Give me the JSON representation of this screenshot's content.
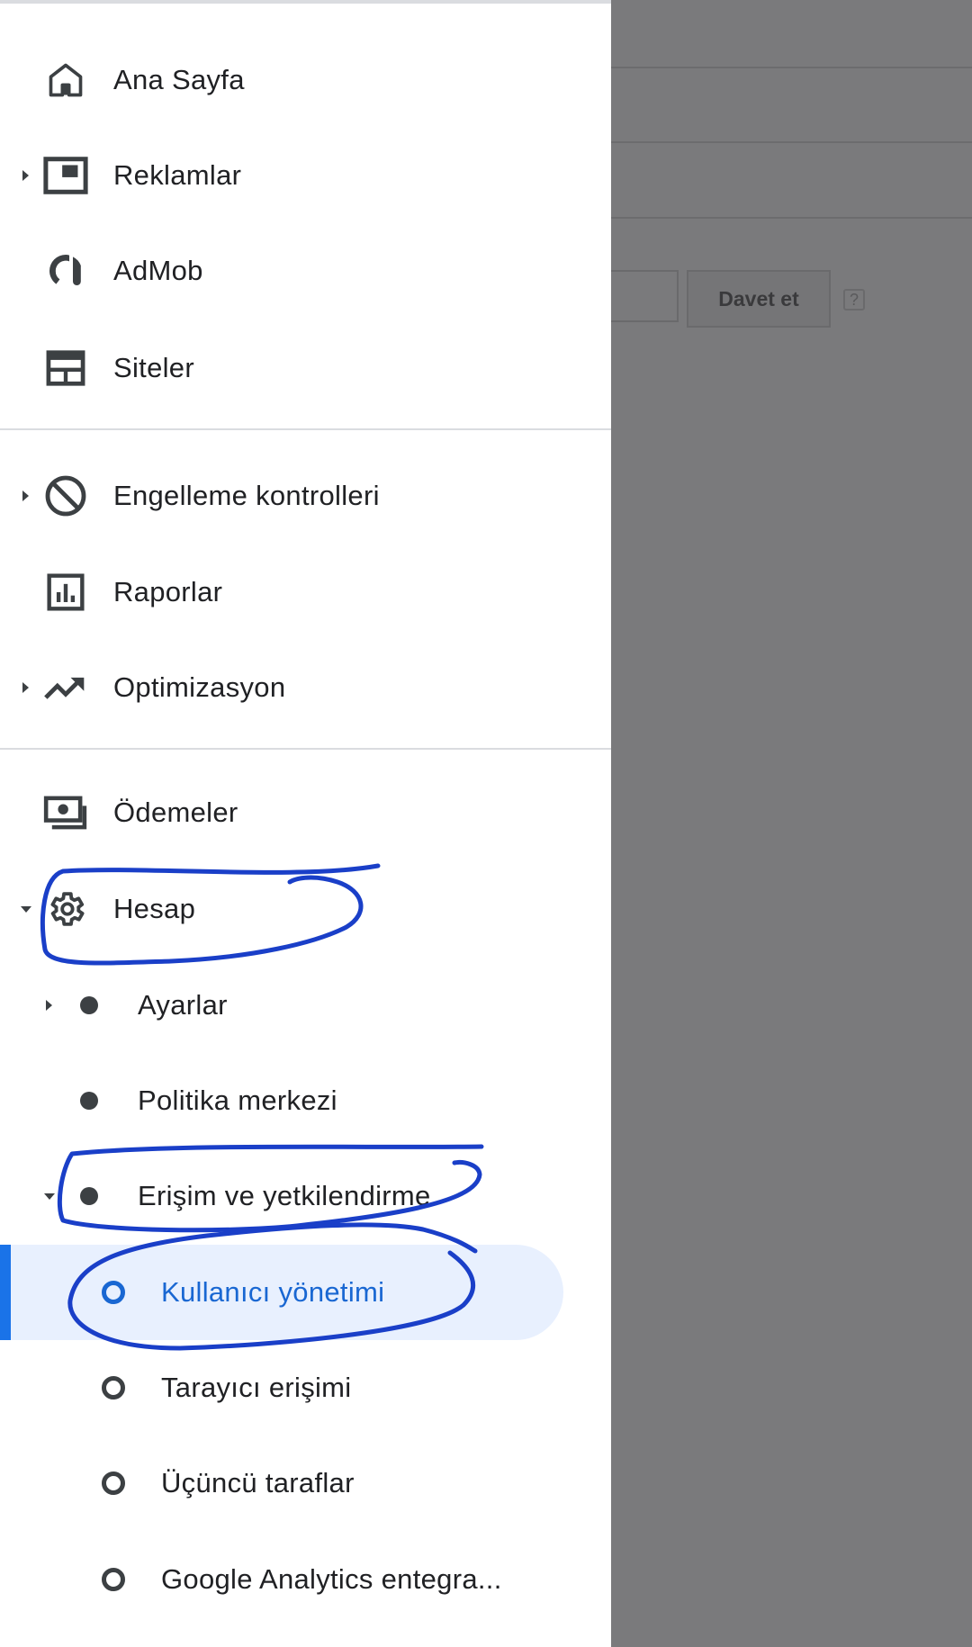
{
  "background": {
    "invite_button": "Davet et",
    "help_icon": "?"
  },
  "nav": {
    "home": "Ana Sayfa",
    "ads": "Reklamlar",
    "admob": "AdMob",
    "sites": "Siteler",
    "blocking": "Engelleme kontrolleri",
    "reports": "Raporlar",
    "optimization": "Optimizasyon",
    "payments": "Ödemeler",
    "account": "Hesap",
    "settings": "Ayarlar",
    "policy_center": "Politika merkezi",
    "access": "Erişim ve yetkilendirme",
    "user_management": "Kullanıcı yönetimi",
    "crawler_access": "Tarayıcı erişimi",
    "third_parties": "Üçüncü taraflar",
    "analytics": "Google Analytics entegra..."
  },
  "colors": {
    "active_text": "#1967d2",
    "active_bg": "#e8f0fe",
    "active_bar": "#1a73e8",
    "annotation": "#1a3fc8",
    "scrim": "#7a7a7c"
  }
}
